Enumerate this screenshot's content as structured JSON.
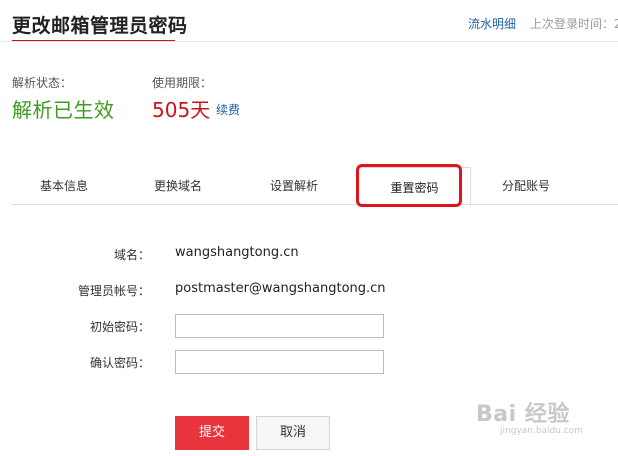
{
  "header": {
    "title": "更改邮箱管理员密码",
    "flow_link": "流水明细",
    "last_login": "上次登录时间：2"
  },
  "status": {
    "parse_label": "解析状态：",
    "parse_value": "解析已生效",
    "expiry_label": "使用期限：",
    "expiry_value": "505天",
    "renew_link": "续费"
  },
  "tabs": [
    {
      "label": "基本信息"
    },
    {
      "label": "更换域名"
    },
    {
      "label": "设置解析"
    },
    {
      "label": "重置密码",
      "active": true
    },
    {
      "label": "分配账号"
    }
  ],
  "form": {
    "domain_label": "域名：",
    "domain_value": "wangshangtong.cn",
    "admin_label": "管理员帐号：",
    "admin_value": "postmaster@wangshangtong.cn",
    "initial_pwd_label": "初始密码：",
    "initial_pwd_value": "",
    "confirm_pwd_label": "确认密码：",
    "confirm_pwd_value": ""
  },
  "buttons": {
    "submit": "提交",
    "cancel": "取消"
  },
  "watermark": {
    "main": "Bai  经验",
    "sub": "jingyan.baidu.com"
  },
  "colors": {
    "accent_red": "#c8161d",
    "status_green": "#3d9b1f",
    "link_blue": "#1e5fa8",
    "submit_red": "#e8343c",
    "highlight_red": "#e0141b"
  }
}
